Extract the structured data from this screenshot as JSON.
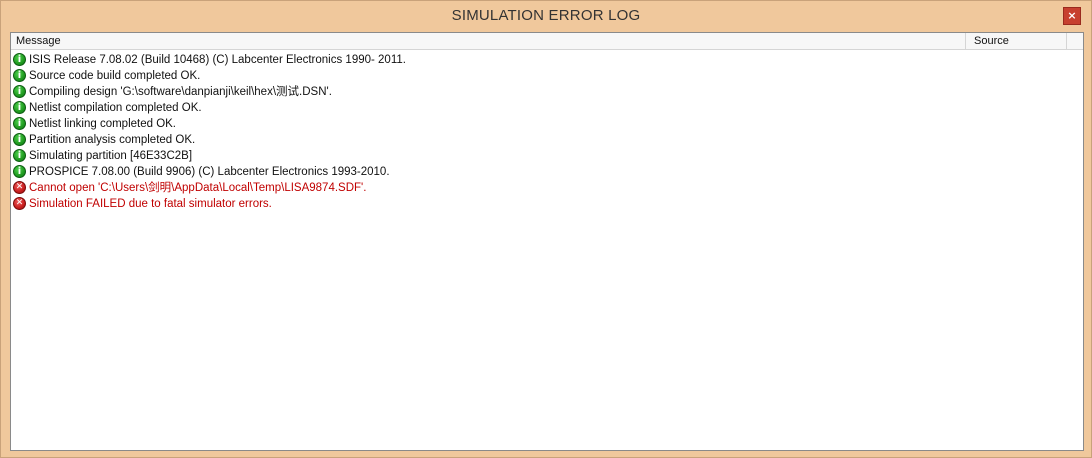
{
  "window": {
    "title": "SIMULATION ERROR LOG",
    "close_label": "×"
  },
  "header": {
    "message": "Message",
    "source": "Source"
  },
  "icons": {
    "info": "info-icon",
    "error": "error-icon",
    "info_glyph": "i",
    "error_glyph": "✕"
  },
  "colors": {
    "info_text": "#111111",
    "error_text": "#c00000",
    "titlebar": "#f0c89c"
  },
  "rows": [
    {
      "type": "info",
      "message": "ISIS Release 7.08.02 (Build 10468) (C) Labcenter Electronics 1990- 2011."
    },
    {
      "type": "info",
      "message": "Source code build completed OK."
    },
    {
      "type": "info",
      "message": "Compiling design 'G:\\software\\danpianji\\keil\\hex\\测试.DSN'."
    },
    {
      "type": "info",
      "message": "Netlist compilation completed OK."
    },
    {
      "type": "info",
      "message": "Netlist linking completed OK."
    },
    {
      "type": "info",
      "message": "Partition analysis completed OK."
    },
    {
      "type": "info",
      "message": "Simulating partition [46E33C2B]"
    },
    {
      "type": "info",
      "message": "PROSPICE 7.08.00 (Build 9906) (C) Labcenter Electronics 1993-2010."
    },
    {
      "type": "error",
      "message": "Cannot open 'C:\\Users\\剑明\\AppData\\Local\\Temp\\LISA9874.SDF'."
    },
    {
      "type": "error",
      "message": "Simulation FAILED due to fatal simulator errors."
    }
  ]
}
